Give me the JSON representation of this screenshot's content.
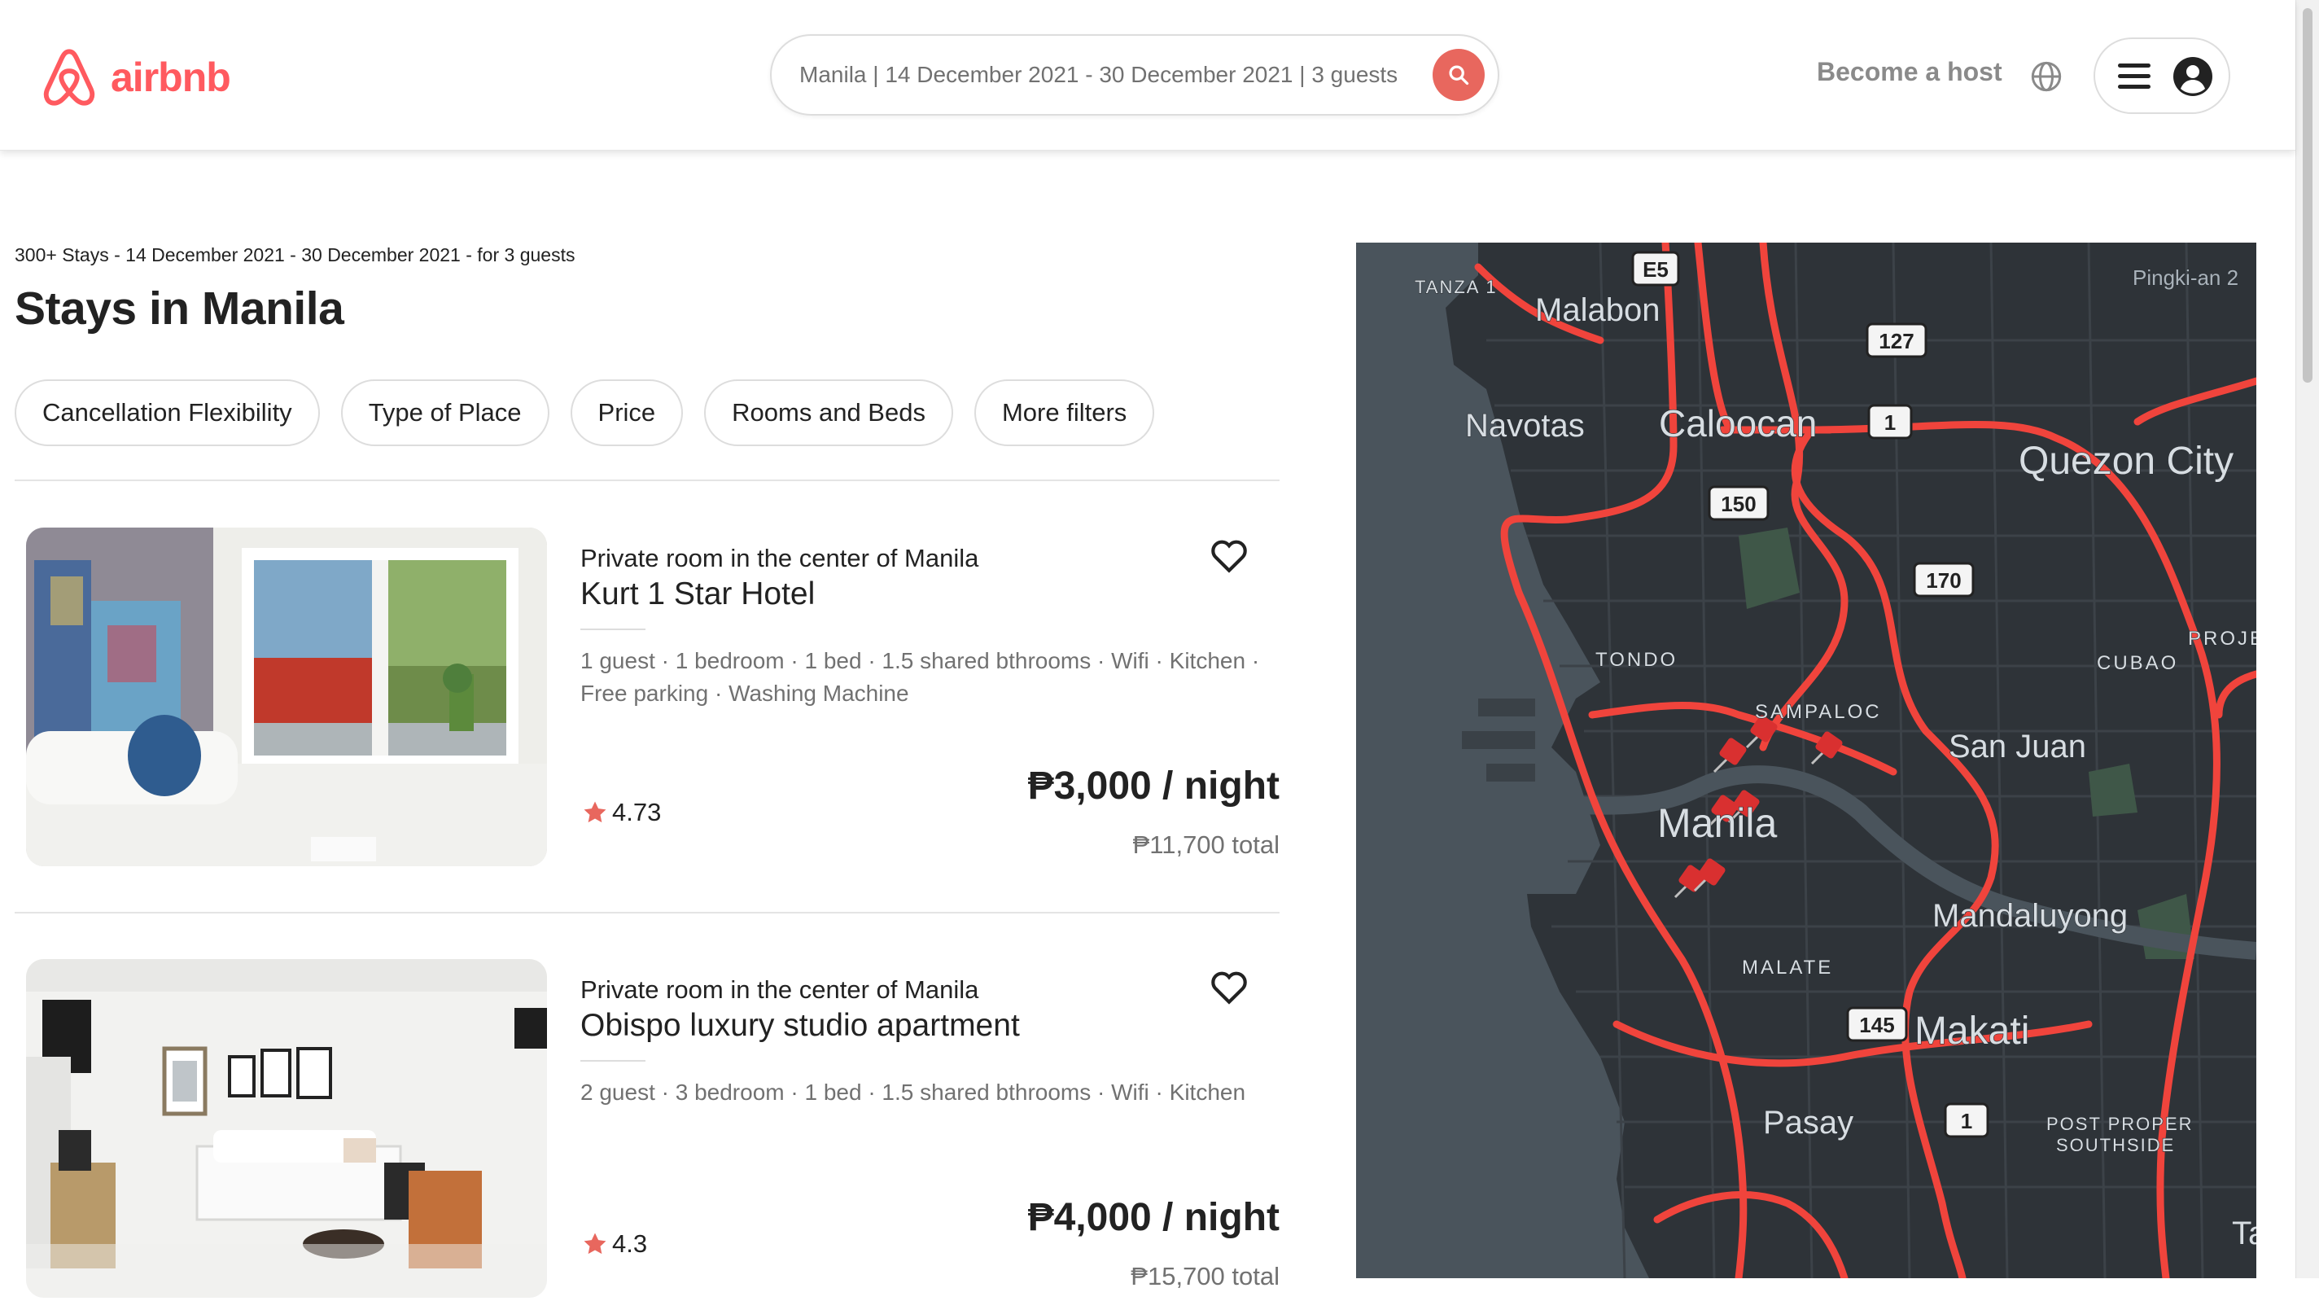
{
  "header": {
    "logo_text": "airbnb",
    "search_summary": "Manila | 14 December 2021 - 30 December 2021 | 3 guests",
    "host_link": "Become a host",
    "brand_color": "#FF5A5F"
  },
  "results": {
    "summary": "300+ Stays - 14 December 2021 - 30 December 2021 - for 3 guests",
    "title": "Stays in Manila"
  },
  "filters": [
    "Cancellation Flexibility",
    "Type of Place",
    "Price",
    "Rooms and Beds",
    "More filters"
  ],
  "listings": [
    {
      "type": "Private room in the center of Manila",
      "name": "Kurt 1 Star Hotel",
      "amenities": "1 guest · 1 bedroom · 1 bed · 1.5 shared bthrooms · Wifi · Kitchen · Free parking · Washing Machine",
      "rating": "4.73",
      "price": "₱3,000 / night",
      "total": "₱11,700 total"
    },
    {
      "type": "Private room in the center of Manila",
      "name": "Obispo luxury studio apartment",
      "amenities": "2 guest · 3 bedroom · 1 bed · 1.5 shared bthrooms · Wifi · Kitchen",
      "rating": "4.3",
      "price": "₱4,000 / night",
      "total": "₱15,700 total"
    }
  ],
  "map": {
    "labels": {
      "malabon": "Malabon",
      "navotas": "Navotas",
      "caloocan": "Caloocan",
      "quezon_city": "Quezon City",
      "tondo": "TONDO",
      "sampaloc": "SAMPALOC",
      "san_juan": "San Juan",
      "cubao": "CUBAO",
      "manila": "Manila",
      "mandaluyong": "Mandaluyong",
      "malate": "MALATE",
      "makati": "Makati",
      "pasay": "Pasay",
      "post_proper": "POST PROPER",
      "southside": "SOUTHSIDE",
      "tanza": "TANZA 1",
      "pingki": "Pingki-an 2",
      "proje": "PROJE",
      "ta": "Ta"
    },
    "shields": {
      "e5": "E5",
      "r127": "127",
      "r1_north": "1",
      "r150": "150",
      "r170": "170",
      "r145": "145",
      "r1_south": "1"
    }
  }
}
